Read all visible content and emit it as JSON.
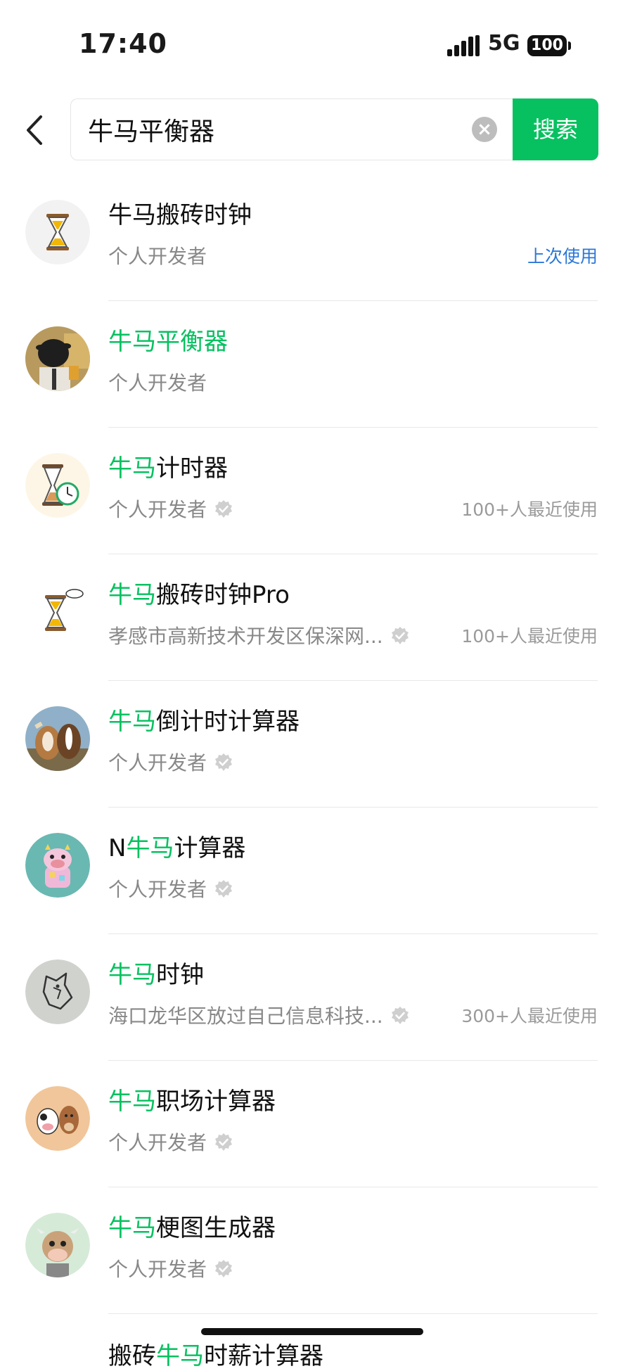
{
  "status": {
    "time": "17:40",
    "network": "5G",
    "battery": "100"
  },
  "search": {
    "query": "牛马平衡器",
    "button_label": "搜索"
  },
  "results": [
    {
      "title_pre": "",
      "title_hl": "",
      "title_post": "牛马搬砖时钟",
      "subtitle": "个人开发者",
      "verified": false,
      "right": "上次使用",
      "right_style": "blue",
      "avatar": "hourglass"
    },
    {
      "title_pre": "",
      "title_hl": "牛马平衡器",
      "title_post": "",
      "subtitle": "个人开发者",
      "verified": false,
      "right": "",
      "avatar": "cow-photo"
    },
    {
      "title_pre": "",
      "title_hl": "牛马",
      "title_post": "计时器",
      "subtitle": "个人开发者",
      "verified": true,
      "right": "100+人最近使用",
      "avatar": "hourglass-clock"
    },
    {
      "title_pre": "",
      "title_hl": "牛马",
      "title_post": "搬砖时钟Pro",
      "subtitle": "孝感市高新技术开发区保深网...",
      "verified": true,
      "right": "100+人最近使用",
      "avatar": "hourglass-pro"
    },
    {
      "title_pre": "",
      "title_hl": "牛马",
      "title_post": "倒计时计算器",
      "subtitle": "个人开发者",
      "verified": true,
      "right": "",
      "avatar": "cow-horse"
    },
    {
      "title_pre": "N",
      "title_hl": "牛马",
      "title_post": "计算器",
      "subtitle": "个人开发者",
      "verified": true,
      "right": "",
      "avatar": "toy-cow"
    },
    {
      "title_pre": "",
      "title_hl": "牛马",
      "title_post": "时钟",
      "subtitle": "海口龙华区放过自己信息科技...",
      "verified": true,
      "right": "300+人最近使用",
      "avatar": "line-horse"
    },
    {
      "title_pre": "",
      "title_hl": "牛马",
      "title_post": "职场计算器",
      "subtitle": "个人开发者",
      "verified": true,
      "right": "",
      "avatar": "cartoon-pair"
    },
    {
      "title_pre": "",
      "title_hl": "牛马",
      "title_post": "梗图生成器",
      "subtitle": "个人开发者",
      "verified": true,
      "right": "",
      "avatar": "cartoon-cow"
    }
  ],
  "partial": {
    "pre": "搬砖",
    "hl": "牛马",
    "post": "时薪计算器"
  },
  "colors": {
    "accent": "#07c160",
    "link": "#2b78d8",
    "muted": "#888888"
  }
}
